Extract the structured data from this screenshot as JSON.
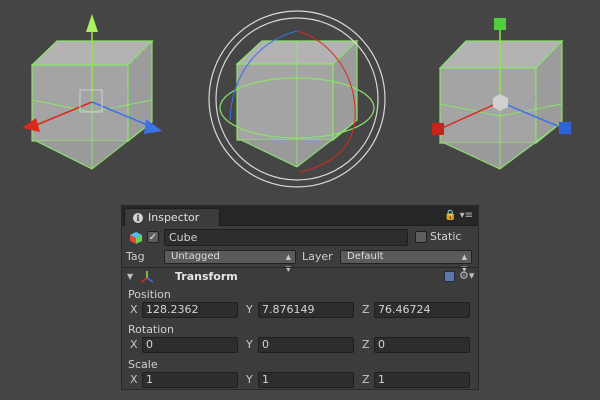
{
  "viewport": {
    "gizmos": [
      "move-gizmo",
      "rotate-gizmo",
      "scale-gizmo"
    ],
    "colors": {
      "x_axis": "#d92a1c",
      "y_axis": "#8ee64a",
      "z_axis": "#3b72e8",
      "selection": "#8be36a",
      "cube_face": "#a6a6a6"
    }
  },
  "inspector": {
    "tab_label": "Inspector",
    "tab_tools": "🔒 ▾≡",
    "object": {
      "active": true,
      "name": "Cube",
      "static_label": "Static",
      "static": false
    },
    "tag": {
      "label": "Tag",
      "value": "Untagged"
    },
    "layer": {
      "label": "Layer",
      "value": "Default"
    },
    "component": {
      "foldout": "▼",
      "title": "Transform",
      "help_icon": "book-icon",
      "settings_icon": "gear-icon"
    },
    "position": {
      "label": "Position",
      "x_label": "X",
      "y_label": "Y",
      "z_label": "Z",
      "x": "128.2362",
      "y": "7.876149",
      "z": "76.46724"
    },
    "rotation": {
      "label": "Rotation",
      "x_label": "X",
      "y_label": "Y",
      "z_label": "Z",
      "x": "0",
      "y": "0",
      "z": "0"
    },
    "scale": {
      "label": "Scale",
      "x_label": "X",
      "y_label": "Y",
      "z_label": "Z",
      "x": "1",
      "y": "1",
      "z": "1"
    }
  }
}
